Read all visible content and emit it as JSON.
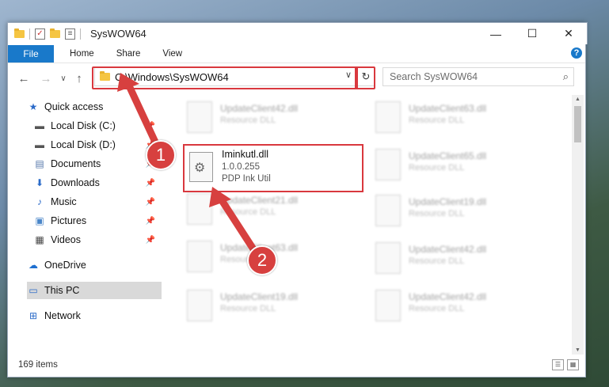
{
  "window": {
    "title": "SysWOW64",
    "minimize": "—",
    "maximize": "☐",
    "close": "✕"
  },
  "ribbon": {
    "file": "File",
    "tabs": [
      "Home",
      "Share",
      "View"
    ],
    "help": "?"
  },
  "nav": {
    "back": "←",
    "forward": "→",
    "dropdown": "∨",
    "up": "↑",
    "address": "C:\\Windows\\SysWOW64",
    "refresh": "↻",
    "search_placeholder": "Search SysWOW64",
    "search_icon": "⌕"
  },
  "sidebar": {
    "items": [
      {
        "label": "Quick access",
        "icon": "★",
        "pinned": false
      },
      {
        "label": "Local Disk (C:)",
        "icon": "▬",
        "pinned": true
      },
      {
        "label": "Local Disk (D:)",
        "icon": "▬",
        "pinned": true
      },
      {
        "label": "Documents",
        "icon": "▤",
        "pinned": true
      },
      {
        "label": "Downloads",
        "icon": "⬇",
        "pinned": true
      },
      {
        "label": "Music",
        "icon": "♪",
        "pinned": true
      },
      {
        "label": "Pictures",
        "icon": "▣",
        "pinned": true
      },
      {
        "label": "Videos",
        "icon": "▦",
        "pinned": true
      },
      {
        "label": "OneDrive",
        "icon": "☁",
        "pinned": false
      },
      {
        "label": "This PC",
        "icon": "▭",
        "pinned": false
      },
      {
        "label": "Network",
        "icon": "⊞",
        "pinned": false
      }
    ],
    "pin_icon": "📌"
  },
  "files": {
    "left_column": [
      {
        "name": "UpdateClient42.dll",
        "desc": "Resource DLL"
      },
      {
        "name": "UpdateClient21.dll",
        "desc": "Resource DLL"
      },
      {
        "name": "UpdateClient63.dll",
        "desc": "Resource DLL"
      },
      {
        "name": "UpdateClient19.dll",
        "desc": "Resource DLL"
      }
    ],
    "right_column": [
      {
        "name": "UpdateClient63.dll",
        "desc": "Resource DLL"
      },
      {
        "name": "UpdateClient65.dll",
        "desc": "Resource DLL"
      },
      {
        "name": "UpdateClient19.dll",
        "desc": "Resource DLL"
      },
      {
        "name": "UpdateClient42.dll",
        "desc": "Resource DLL"
      },
      {
        "name": "UpdateClient42.dll",
        "desc": "Resource DLL"
      }
    ],
    "highlighted": {
      "name": "Iminkutl.dll",
      "version": "1.0.0.255",
      "desc": "PDP Ink Util",
      "icon": "⚙"
    }
  },
  "status": {
    "items": "169 items",
    "details_view": "☰",
    "icons_view": "▦"
  },
  "badges": {
    "one": "1",
    "two": "2"
  },
  "colors": {
    "accent": "#1979ca",
    "highlight": "#d9383e"
  }
}
